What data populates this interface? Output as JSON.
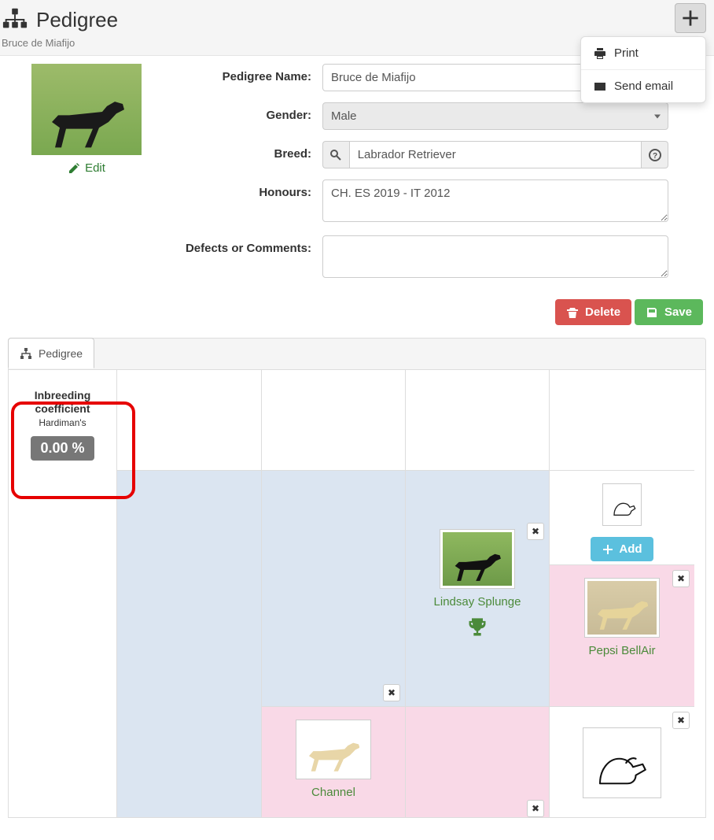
{
  "header": {
    "title": "Pedigree",
    "subtitle": "Bruce de Miafijo",
    "menu": {
      "print": "Print",
      "send_email": "Send email"
    }
  },
  "photo": {
    "edit": "Edit"
  },
  "form": {
    "labels": {
      "name": "Pedigree Name:",
      "gender": "Gender:",
      "breed": "Breed:",
      "honours": "Honours:",
      "defects": "Defects or Comments:"
    },
    "values": {
      "name": "Bruce de Miafijo",
      "gender": "Male",
      "breed": "Labrador Retriever",
      "honours": "CH. ES 2019 - IT 2012",
      "defects": ""
    }
  },
  "actions": {
    "delete": "Delete",
    "save": "Save"
  },
  "tabs": {
    "pedigree": "Pedigree"
  },
  "coefficient": {
    "title_l1": "Inbreeding",
    "title_l2": "coefficient",
    "subtitle": "Hardiman's",
    "value": "0.00 %"
  },
  "tree": {
    "add_label": "Add",
    "nodes": {
      "father": "Lindsay Splunge",
      "mother": "Channel",
      "paternal_gm": "Pepsi BellAir"
    }
  }
}
